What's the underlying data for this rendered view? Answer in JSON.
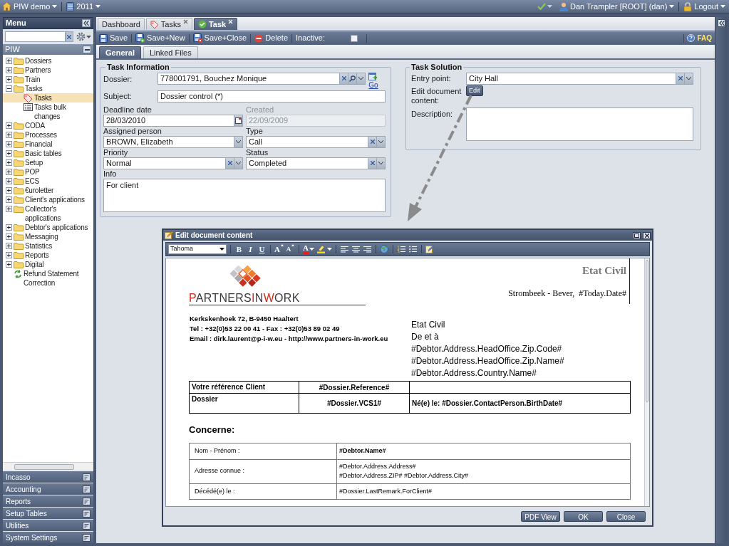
{
  "top_bar": {
    "app": "PIW demo",
    "year": "2011",
    "user": "Dan Trampler [ROOT] (dan)",
    "logout": "Logout"
  },
  "sidebar": {
    "title": "Menu",
    "section": "PIW",
    "tree": [
      {
        "label": "Dossiers",
        "kind": "folder",
        "expanded": false,
        "selected": false
      },
      {
        "label": "Partners",
        "kind": "folder",
        "expanded": false,
        "selected": false
      },
      {
        "label": "Train",
        "kind": "folder",
        "expanded": false,
        "selected": false
      },
      {
        "label": "Tasks",
        "kind": "folder",
        "expanded": true,
        "selected": false,
        "children": [
          {
            "label": "Tasks",
            "kind": "tag",
            "selected": true
          },
          {
            "label": "Tasks bulk changes",
            "kind": "list",
            "selected": false
          }
        ]
      },
      {
        "label": "CODA",
        "kind": "folder",
        "expanded": false,
        "selected": false
      },
      {
        "label": "Processes",
        "kind": "folder",
        "expanded": false,
        "selected": false
      },
      {
        "label": "Financial",
        "kind": "folder",
        "expanded": false,
        "selected": false
      },
      {
        "label": "Basic tables",
        "kind": "folder",
        "expanded": false,
        "selected": false
      },
      {
        "label": "Setup",
        "kind": "folder",
        "expanded": false,
        "selected": false
      },
      {
        "label": "POP",
        "kind": "folder",
        "expanded": false,
        "selected": false
      },
      {
        "label": "ECS",
        "kind": "folder",
        "expanded": false,
        "selected": false
      },
      {
        "label": "€uroletter",
        "kind": "folder",
        "expanded": false,
        "selected": false
      },
      {
        "label": "Client's applications",
        "kind": "folder",
        "expanded": false,
        "selected": false
      },
      {
        "label": "Collector's applications",
        "kind": "folder",
        "expanded": false,
        "selected": false
      },
      {
        "label": "Debtor's applications",
        "kind": "folder",
        "expanded": false,
        "selected": false
      },
      {
        "label": "Messaging",
        "kind": "folder",
        "expanded": false,
        "selected": false
      },
      {
        "label": "Statistics",
        "kind": "folder",
        "expanded": false,
        "selected": false
      },
      {
        "label": "Reports",
        "kind": "folder",
        "expanded": false,
        "selected": false
      },
      {
        "label": "Digital",
        "kind": "folder",
        "expanded": false,
        "selected": false
      },
      {
        "label": "Refund Statement Correction",
        "kind": "action",
        "selected": false
      }
    ],
    "accordion": [
      "Incasso",
      "Accounting",
      "Reports",
      "Setup Tables",
      "Utilities",
      "System Settings"
    ]
  },
  "tabs": [
    {
      "label": "Dashboard",
      "kind": "plain",
      "closable": false,
      "selected": false
    },
    {
      "label": "Tasks",
      "kind": "tag",
      "closable": true,
      "selected": false
    },
    {
      "label": "Task",
      "kind": "check",
      "closable": true,
      "selected": true
    }
  ],
  "toolbar": {
    "buttons": [
      {
        "label": "Save",
        "kind": "save"
      },
      {
        "label": "Save+New",
        "kind": "save-new"
      },
      {
        "label": "Save+Close",
        "kind": "save-close"
      },
      {
        "label": "Delete",
        "kind": "delete"
      }
    ],
    "inactive": {
      "label": "Inactive:",
      "checked": false
    },
    "faq": "FAQ"
  },
  "subtabs": [
    {
      "label": "General",
      "selected": true
    },
    {
      "label": "Linked Files",
      "selected": false
    }
  ],
  "task_information": {
    "title": "Task Information",
    "dossier": {
      "label": "Dossier:",
      "value": "778001791, Bouchez Monique",
      "go": "Go"
    },
    "subject": {
      "label": "Subject:",
      "value": "Dossier control (*)"
    },
    "deadline": {
      "label": "Deadline date",
      "value": "28/03/2010"
    },
    "created": {
      "label": "Created",
      "value": "22/09/2009",
      "disabled": true
    },
    "assigned": {
      "label": "Assigned person",
      "value": "BROWN, Elizabeth",
      "clearable": false
    },
    "type": {
      "label": "Type",
      "value": "Call",
      "clearable": true
    },
    "priority": {
      "label": "Priority",
      "value": "Normal",
      "clearable": true
    },
    "status": {
      "label": "Status",
      "value": "Completed",
      "clearable": true
    },
    "info": {
      "label": "Info",
      "value": "For client"
    }
  },
  "task_solution": {
    "title": "Task Solution",
    "entry_point": {
      "label": "Entry point:",
      "value": "City Hall",
      "clearable": true
    },
    "edit_document": {
      "label": "Edit document content:",
      "button": "Edit"
    },
    "description": {
      "label": "Description:"
    }
  },
  "dialog": {
    "title": "Edit document content",
    "editor_toolbar": {
      "font": "Tahoma",
      "button_groups": [
        [
          {
            "kind": "bold",
            "glyph": "B"
          },
          {
            "kind": "italic",
            "glyph": "I"
          },
          {
            "kind": "underline",
            "glyph": "U"
          }
        ],
        [
          {
            "kind": "grow-font",
            "glyph": "A"
          },
          {
            "kind": "shrink-font",
            "glyph": "A"
          }
        ],
        [
          {
            "kind": "font-color",
            "glyph": "A"
          },
          {
            "kind": "highlight"
          }
        ],
        [
          {
            "kind": "align-left"
          },
          {
            "kind": "align-center"
          },
          {
            "kind": "align-right"
          }
        ],
        [
          {
            "kind": "link"
          }
        ],
        [
          {
            "kind": "ordered-list"
          },
          {
            "kind": "bullet-list"
          }
        ],
        [
          {
            "kind": "source"
          }
        ]
      ]
    },
    "document": {
      "logo": [
        {
          "text": "P",
          "accent": true
        },
        {
          "text": "ARTNERS",
          "accent": false
        },
        {
          "text": "I",
          "accent": true
        },
        {
          "text": "N",
          "accent": false
        },
        {
          "text": "W",
          "accent": true
        },
        {
          "text": "ORK",
          "accent": false
        }
      ],
      "heading": "Etat Civil",
      "place_date": "Strombeek - Bever,  #Today.Date#",
      "address": [
        "Kerkskenhoek 72, B-9450 Haaltert",
        "Tel : +32(0)53 22 00 41 - Fax : +32(0)53 89 02 49",
        "Email : dirk.laurent@p-i-w.eu - http://www.partners-in-work.eu"
      ],
      "recipient": [
        "Etat Civil",
        "De et à",
        "#Debtor.Address.HeadOffice.Zip.Code#",
        "#Debtor.Address.HeadOffice.Zip.Name#",
        "#Debtor.Address.Country.Name#"
      ],
      "reference_table": [
        {
          "cells": [
            "Votre référence Client",
            "#Dossier.Reference#"
          ]
        },
        {
          "cells": [
            "Dossier",
            "#Dossier.VCS1#",
            "Né(e) le: #Dossier.ContactPerson.BirthDate#"
          ]
        }
      ],
      "concerne": "Concerne:",
      "details_table": [
        {
          "label": "Nom - Prénom :",
          "value": [
            "#Debtor.Name#"
          ],
          "emphasis": true
        },
        {
          "label": "Adresse connue :",
          "value": [
            "#Debtor.Address.Address#",
            "#Debtor.Address.ZIP# #Debtor.Address.City#"
          ],
          "emphasis": false
        },
        {
          "label": "Décédé(e) le :",
          "value": [
            "#Dossier.LastRemark.ForClient#"
          ],
          "emphasis": false
        }
      ]
    },
    "buttons": [
      "PDF View",
      "OK",
      "Close"
    ]
  }
}
